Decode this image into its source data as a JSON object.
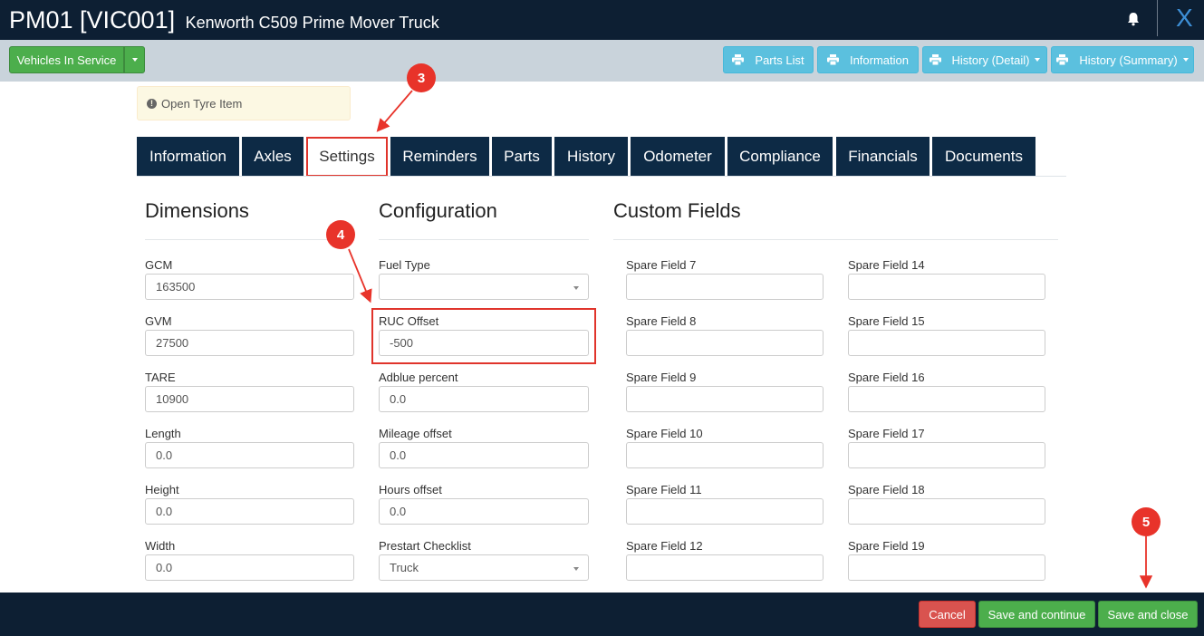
{
  "header": {
    "code": "PM01 [VIC001]",
    "subtitle": "Kenworth C509 Prime Mover Truck",
    "close_label": "X"
  },
  "toolbar": {
    "status_label": "Vehicles In Service",
    "buttons": {
      "parts_list": "Parts List",
      "information": "Information",
      "history_detail": "History (Detail)",
      "history_summary": "History (Summary)"
    }
  },
  "alert": {
    "text": "Open Tyre Item"
  },
  "tabs": [
    "Information",
    "Axles",
    "Settings",
    "Reminders",
    "Parts",
    "History",
    "Odometer",
    "Compliance",
    "Financials",
    "Documents"
  ],
  "active_tab": "Settings",
  "dimensions": {
    "title": "Dimensions",
    "fields": [
      {
        "label": "GCM",
        "value": "163500"
      },
      {
        "label": "GVM",
        "value": "27500"
      },
      {
        "label": "TARE",
        "value": "10900"
      },
      {
        "label": "Length",
        "value": "0.0"
      },
      {
        "label": "Height",
        "value": "0.0"
      },
      {
        "label": "Width",
        "value": "0.0"
      }
    ]
  },
  "configuration": {
    "title": "Configuration",
    "fields": [
      {
        "label": "Fuel Type",
        "value": ""
      },
      {
        "label": "RUC Offset",
        "value": "-500"
      },
      {
        "label": "Adblue percent",
        "value": "0.0"
      },
      {
        "label": "Mileage offset",
        "value": "0.0"
      },
      {
        "label": "Hours offset",
        "value": "0.0"
      },
      {
        "label": "Prestart Checklist",
        "value": "Truck"
      }
    ]
  },
  "custom_fields": {
    "title": "Custom Fields",
    "left": [
      {
        "label": "Spare Field 7",
        "value": ""
      },
      {
        "label": "Spare Field 8",
        "value": ""
      },
      {
        "label": "Spare Field 9",
        "value": ""
      },
      {
        "label": "Spare Field 10",
        "value": ""
      },
      {
        "label": "Spare Field 11",
        "value": ""
      },
      {
        "label": "Spare Field 12",
        "value": ""
      }
    ],
    "right": [
      {
        "label": "Spare Field 14",
        "value": ""
      },
      {
        "label": "Spare Field 15",
        "value": ""
      },
      {
        "label": "Spare Field 16",
        "value": ""
      },
      {
        "label": "Spare Field 17",
        "value": ""
      },
      {
        "label": "Spare Field 18",
        "value": ""
      },
      {
        "label": "Spare Field 19",
        "value": ""
      }
    ]
  },
  "annotations": [
    "3",
    "4",
    "5"
  ],
  "footer": {
    "cancel": "Cancel",
    "save_continue": "Save and continue",
    "save_close": "Save and close"
  },
  "colors": {
    "header_bg": "#0d1f33",
    "tab_bg": "#0d2a45",
    "highlight": "#e0342b",
    "green": "#4cae4c",
    "blue": "#5bc0de",
    "red": "#d9534f"
  }
}
